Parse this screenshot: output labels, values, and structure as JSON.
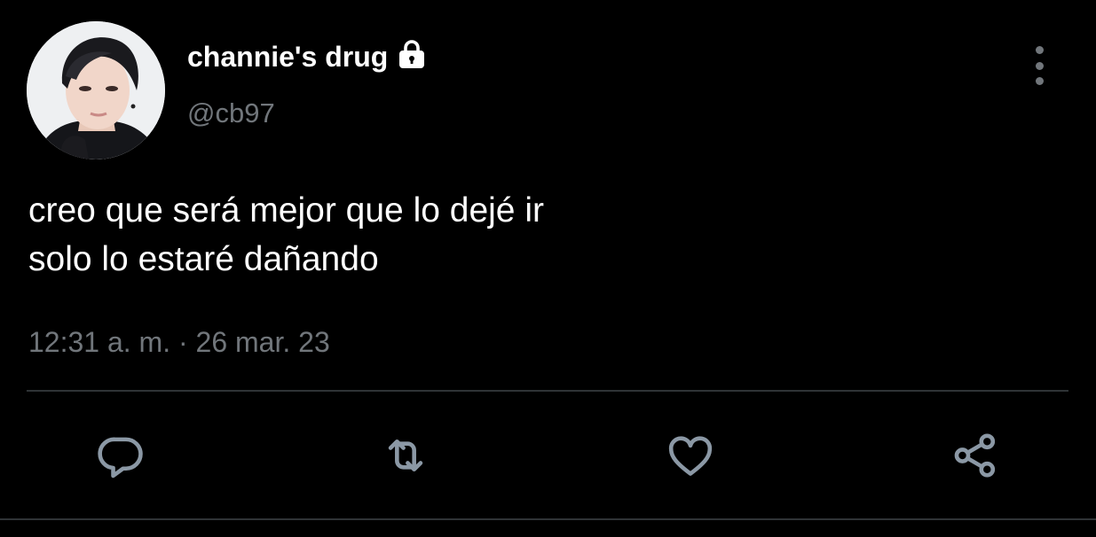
{
  "tweet": {
    "display_name": "channie's drug",
    "handle": "@cb97",
    "text_lines": [
      "creo que será mejor que lo dejé ir",
      "solo lo estaré dañando"
    ],
    "timestamp": "12:31 a. m. · 26 mar. 23",
    "protected": true
  },
  "actions": {
    "reply_icon": "reply-icon",
    "retweet_icon": "retweet-icon",
    "like_icon": "heart-icon",
    "share_icon": "share-icon"
  },
  "colors": {
    "background": "#000000",
    "primary_text": "#ffffff",
    "secondary_text": "#71767b",
    "divider": "#2f3336",
    "icon": "#8b98a5"
  }
}
